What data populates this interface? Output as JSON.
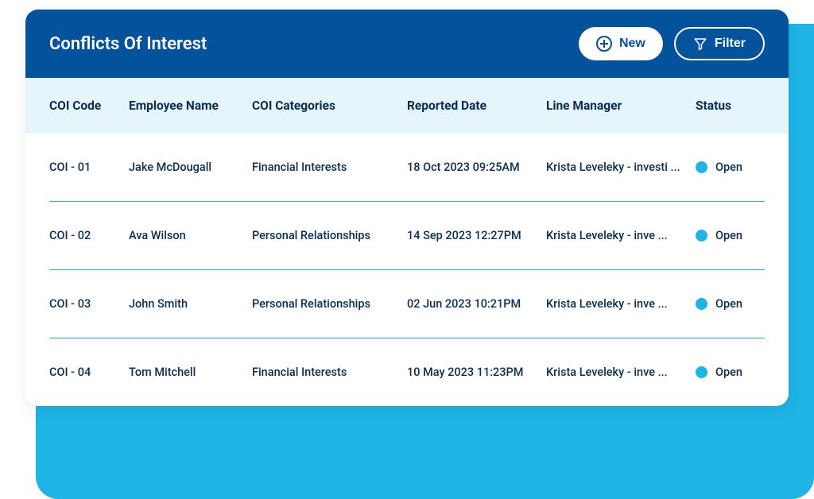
{
  "header": {
    "title": "Conflicts Of Interest",
    "new_label": "New",
    "filter_label": "Filter"
  },
  "table": {
    "columns": {
      "code": "COI Code",
      "employee": "Employee Name",
      "categories": "COI Categories",
      "reported": "Reported Date",
      "manager": "Line Manager",
      "status": "Status"
    },
    "rows": [
      {
        "code": "COI - 01",
        "employee": "Jake McDougall",
        "categories": "Financial Interests",
        "reported": "18 Oct 2023 09:25AM",
        "manager": "Krista Leveleky - investi ...",
        "status": "Open",
        "status_color": "#1eb4e6"
      },
      {
        "code": "COI - 02",
        "employee": "Ava Wilson",
        "categories": "Personal Relationships",
        "reported": "14 Sep 2023 12:27PM",
        "manager": "Krista Leveleky - inve ...",
        "status": "Open",
        "status_color": "#1eb4e6"
      },
      {
        "code": "COI - 03",
        "employee": "John Smith",
        "categories": "Personal Relationships",
        "reported": "02 Jun 2023 10:21PM",
        "manager": "Krista Leveleky - inve ...",
        "status": "Open",
        "status_color": "#1eb4e6"
      },
      {
        "code": "COI - 04",
        "employee": "Tom Mitchell",
        "categories": "Financial Interests",
        "reported": "10 May 2023 11:23PM",
        "manager": "Krista Leveleky - inve ...",
        "status": "Open",
        "status_color": "#1eb4e6"
      }
    ]
  },
  "colors": {
    "header_bg": "#03529c",
    "accent": "#1eb4e6",
    "table_head_bg": "#e6f4fb",
    "text": "#0a2e55"
  }
}
